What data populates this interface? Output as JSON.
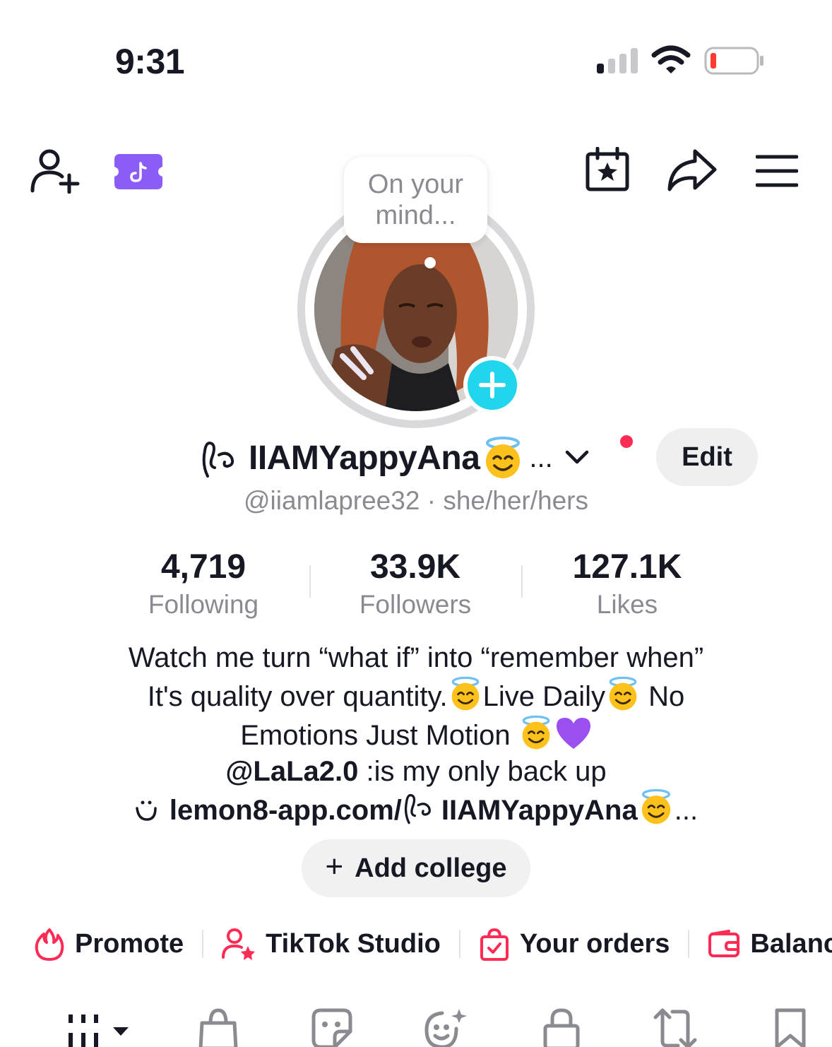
{
  "status_bar": {
    "time": "9:31"
  },
  "bubble": {
    "text": "On your\nmind..."
  },
  "profile": {
    "display_name": "IIAMYappyAna",
    "ellipsis": "...",
    "handle": "@iiamlapree32",
    "pronouns": "she/her/hers",
    "handle_separator": " · ",
    "edit_label": "Edit"
  },
  "stats": [
    {
      "value": "4,719",
      "label": "Following"
    },
    {
      "value": "33.9K",
      "label": "Followers"
    },
    {
      "value": "127.1K",
      "label": "Likes"
    }
  ],
  "bio": {
    "line1": "Watch me turn “what if” into “remember when”",
    "line2a": "It's quality over quantity.",
    "line2b": "Live Daily",
    "line2c": " No",
    "line3": "Emotions Just Motion ",
    "line4_mention": "@LaLa2.0",
    "line4_rest": " :is my only back up",
    "link_prefix": "lemon8-app.com/",
    "link_name": "IIAMYappyAna",
    "link_suffix": "..."
  },
  "college": {
    "plus": "+",
    "label": "Add college"
  },
  "shortcuts": [
    {
      "icon": "flame-icon",
      "label": "Promote"
    },
    {
      "icon": "user-star-icon",
      "label": "TikTok Studio"
    },
    {
      "icon": "shopping-bag-check-icon",
      "label": "Your orders"
    },
    {
      "icon": "wallet-icon",
      "label": "Balance"
    }
  ],
  "colors": {
    "accent": "#fe2c55",
    "cyan": "#20d5ec",
    "purple": "#8b5cf6",
    "gray_text": "#8a8b91"
  }
}
